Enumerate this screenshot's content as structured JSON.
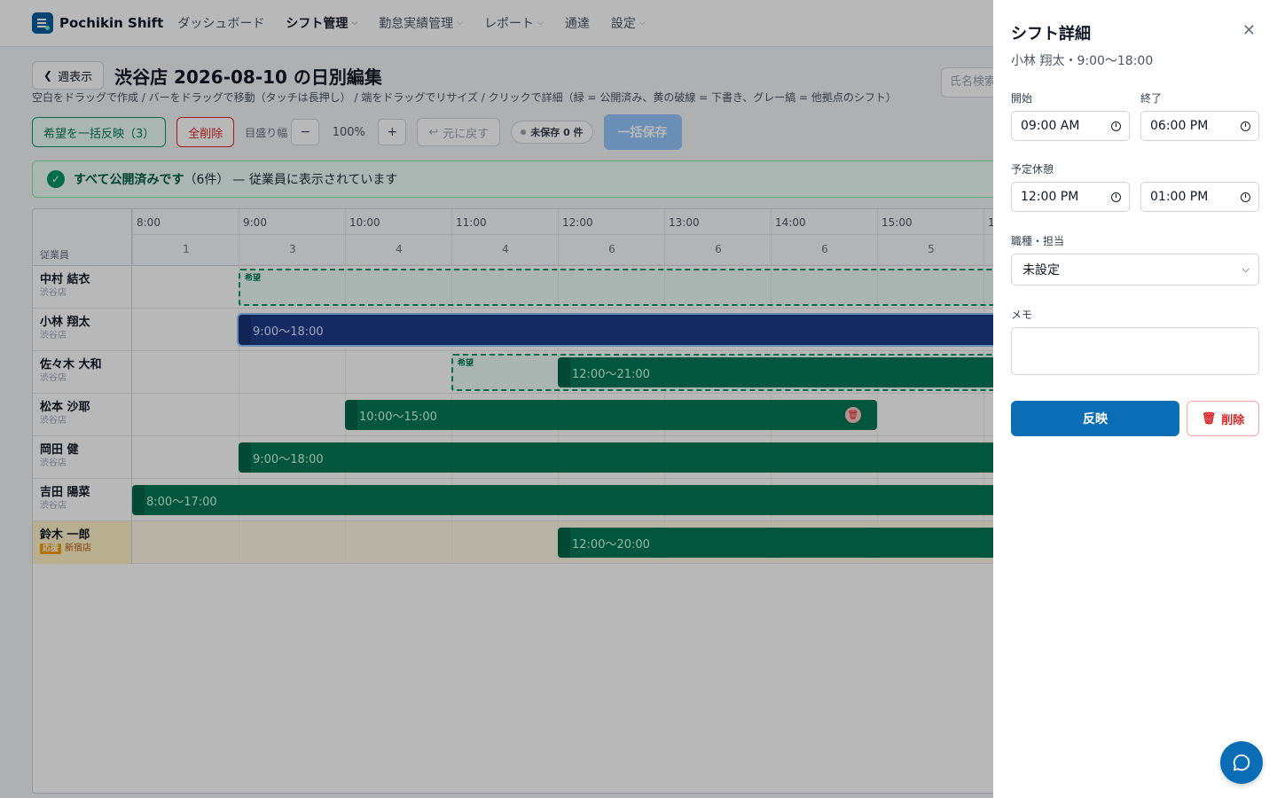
{
  "nav": {
    "brand": "Pochikin Shift",
    "items": [
      {
        "label": "ダッシュボード",
        "has_dropdown": false,
        "active": false
      },
      {
        "label": "シフト管理",
        "has_dropdown": true,
        "active": true
      },
      {
        "label": "勤怠実績管理",
        "has_dropdown": true,
        "active": false
      },
      {
        "label": "レポート",
        "has_dropdown": true,
        "active": false
      },
      {
        "label": "通達",
        "has_dropdown": false,
        "active": false
      },
      {
        "label": "設定",
        "has_dropdown": true,
        "active": false
      }
    ]
  },
  "header": {
    "back_label": "週表示",
    "title": "渋谷店 2026-08-10 の日別編集",
    "search_placeholder": "氏名検索",
    "hint": "空白をドラッグで作成 / バーをドラッグで移動（タッチは長押し） / 端をドラッグでリサイズ / クリックで詳細（緑 = 公開済み、黄の破線 = 下書き、グレー縞 = 他拠点のシフト）"
  },
  "toolbar": {
    "apply_wishes_label": "希望を一括反映（3）",
    "delete_all_label": "全削除",
    "zoom_label": "目盛り幅",
    "zoom_minus": "−",
    "zoom_value": "100%",
    "zoom_plus": "+",
    "undo_label": "元に戻す",
    "unsaved_label": "未保存 0 件",
    "save_all_label": "一括保存"
  },
  "banner": {
    "bold": "すべて公開済みです",
    "count": "（6件）",
    "rest": "— 従業員に表示されています"
  },
  "grid": {
    "employee_header": "従業員",
    "hours": [
      {
        "label": "8:00",
        "count": "1"
      },
      {
        "label": "9:00",
        "count": "3"
      },
      {
        "label": "10:00",
        "count": "4"
      },
      {
        "label": "11:00",
        "count": "4"
      },
      {
        "label": "12:00",
        "count": "6"
      },
      {
        "label": "13:00",
        "count": "6"
      },
      {
        "label": "14:00",
        "count": "6"
      },
      {
        "label": "15:00",
        "count": "5"
      },
      {
        "label": "1",
        "count": ""
      }
    ],
    "wish_label": "希望",
    "employees": [
      {
        "name": "中村 結衣",
        "store": "渋谷店",
        "help": false
      },
      {
        "name": "小林 翔太",
        "store": "渋谷店",
        "help": false
      },
      {
        "name": "佐々木 大和",
        "store": "渋谷店",
        "help": false
      },
      {
        "name": "松本 沙耶",
        "store": "渋谷店",
        "help": false
      },
      {
        "name": "岡田 健",
        "store": "渋谷店",
        "help": false
      },
      {
        "name": "吉田 陽菜",
        "store": "渋谷店",
        "help": false
      },
      {
        "name": "鈴木 一郎",
        "store": "新宿店",
        "help": true,
        "help_tag": "応援"
      }
    ],
    "shifts": [
      {
        "row": 1,
        "label": "9:00〜18:00",
        "start": 9,
        "end": 18,
        "selected": true
      },
      {
        "row": 2,
        "label": "12:00〜21:00",
        "start": 12,
        "end": 21
      },
      {
        "row": 3,
        "label": "10:00〜15:00",
        "start": 10,
        "end": 15,
        "deletable": true
      },
      {
        "row": 4,
        "label": "9:00〜18:00",
        "start": 9,
        "end": 18
      },
      {
        "row": 5,
        "label": "8:00〜17:00",
        "start": 8,
        "end": 17
      },
      {
        "row": 6,
        "label": "12:00〜20:00",
        "start": 12,
        "end": 20
      }
    ],
    "wishes": [
      {
        "row": 0,
        "start": 9,
        "end": 18
      },
      {
        "row": 2,
        "start": 11,
        "end": 18
      }
    ]
  },
  "panel": {
    "title": "シフト詳細",
    "subtitle": "小林 翔太・9:00〜18:00",
    "start_label": "開始",
    "start_value": "09:00 AM",
    "end_label": "終了",
    "end_value": "06:00 PM",
    "break_label": "予定休憩",
    "break_start": "12:00 PM",
    "break_end": "01:00 PM",
    "role_label": "職種・担当",
    "role_value": "未設定",
    "memo_label": "メモ",
    "apply_label": "反映",
    "delete_label": "削除"
  },
  "colors": {
    "primary": "#0b6db5",
    "published": "#047857",
    "selected": "#1e3a8a",
    "danger": "#dc2626"
  }
}
